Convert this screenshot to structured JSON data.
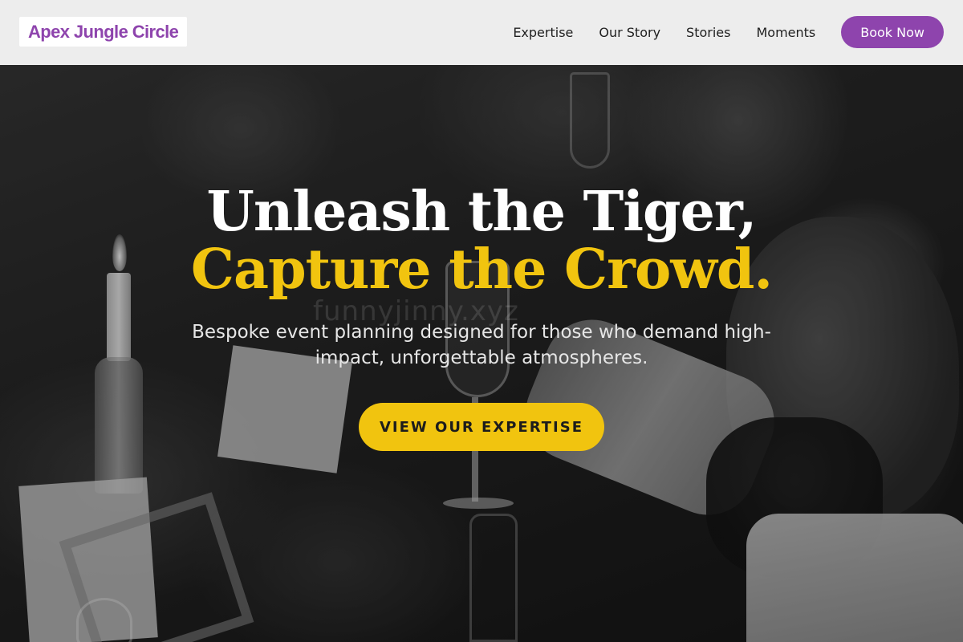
{
  "brand": {
    "name": "Apex Jungle Circle",
    "color": "#8e44ad"
  },
  "nav": {
    "links": [
      {
        "label": "Expertise"
      },
      {
        "label": "Our Story"
      },
      {
        "label": "Stories"
      },
      {
        "label": "Moments"
      }
    ],
    "cta_label": "Book Now"
  },
  "hero": {
    "headline_line1": "Unleash the Tiger,",
    "headline_line2": "Capture the Crowd.",
    "subtitle": "Bespoke event planning designed for those who demand high-impact, unforgettable atmospheres.",
    "cta_label": "VIEW OUR EXPERTISE",
    "watermark": "funnyjinny.xyz",
    "accent_color": "#f1c40f"
  }
}
